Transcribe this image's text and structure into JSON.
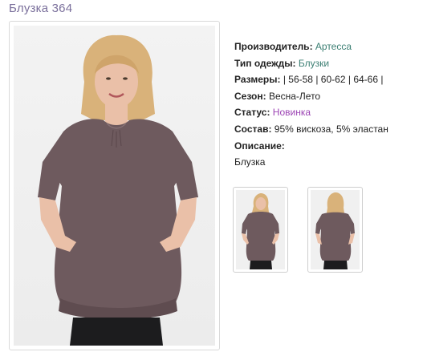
{
  "product": {
    "title": "Блузка 364"
  },
  "details": {
    "manufacturer_label": "Производитель:",
    "manufacturer_value": "Артесса",
    "type_label": "Тип одежды:",
    "type_value": "Блузки",
    "sizes_label": "Размеры:",
    "sizes": [
      "56-58",
      "60-62",
      "64-66"
    ],
    "size_separator": "|",
    "season_label": "Сезон:",
    "season_value": "Весна-Лето",
    "status_label": "Статус:",
    "status_value": "Новинка",
    "composition_label": "Состав:",
    "composition_value": "95% вискоза, 5% эластан",
    "description_label": "Описание:",
    "description_value": "Блузка"
  },
  "colors": {
    "title": "#7a6f9b",
    "link": "#3c7f73",
    "status": "#9c44b4",
    "blouse": "#6e5a5e",
    "pants": "#1c1c1e",
    "hair": "#d9b27a",
    "skin": "#eac0a8"
  },
  "thumbnails": [
    {
      "view": "front"
    },
    {
      "view": "back"
    }
  ]
}
